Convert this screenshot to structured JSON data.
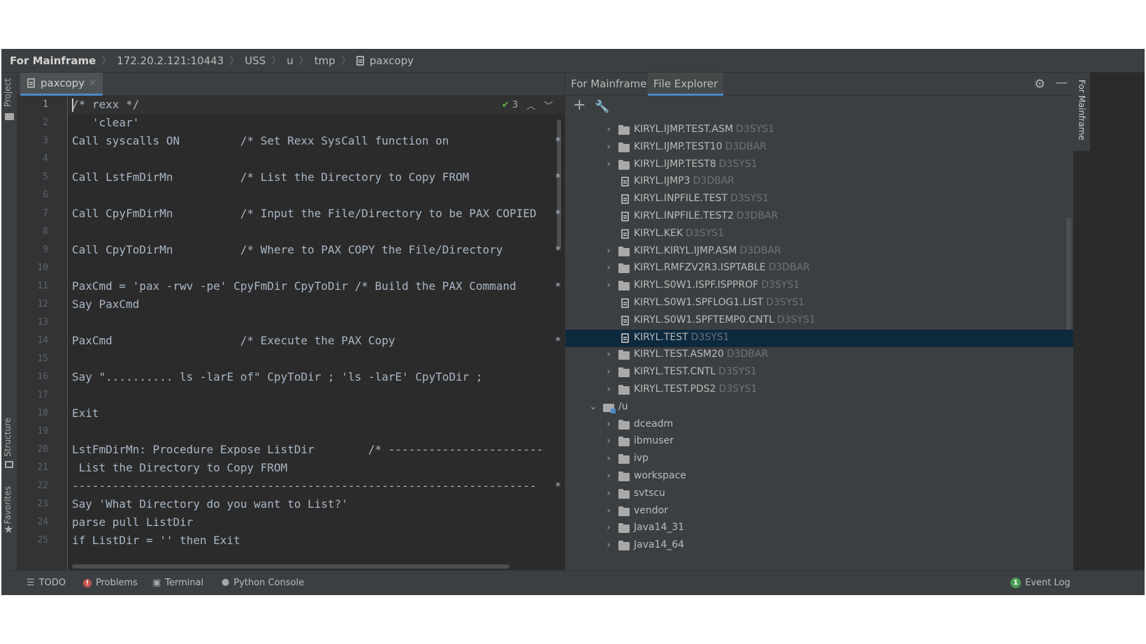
{
  "breadcrumb": {
    "items": [
      "For Mainframe",
      "172.20.2.121:10443",
      "USS",
      "u",
      "tmp"
    ],
    "file": "paxcopy"
  },
  "left_strip": {
    "project": "Project",
    "structure": "Structure",
    "favorites": "Favorites"
  },
  "editor": {
    "tab_label": "paxcopy",
    "inspection_count": "3",
    "line_numbers": [
      "1",
      "2",
      "3",
      "4",
      "5",
      "6",
      "7",
      "8",
      "9",
      "10",
      "11",
      "12",
      "13",
      "14",
      "15",
      "16",
      "17",
      "18",
      "19",
      "20",
      "21",
      "22",
      "23",
      "24",
      "25"
    ],
    "lines": [
      "/* rexx */",
      "   'clear'",
      "Call syscalls ON         /* Set Rexx SysCall function on",
      "",
      "Call LstFmDirMn          /* List the Directory to Copy FROM",
      "",
      "Call CpyFmDirMn          /* Input the File/Directory to be PAX COPIED",
      "",
      "Call CpyToDirMn          /* Where to PAX COPY the File/Directory",
      "",
      "PaxCmd = 'pax -rwv -pe' CpyFmDir CpyToDir /* Build the PAX Command",
      "Say PaxCmd",
      "",
      "PaxCmd                   /* Execute the PAX Copy",
      "",
      "Say \".......... ls -larE of\" CpyToDir ; 'ls -larE' CpyToDir ;",
      "",
      "Exit",
      "",
      "LstFmDirMn: Procedure Expose ListDir        /* -----------------------",
      " List the Directory to Copy FROM",
      "---------------------------------------------------------------------",
      "Say 'What Directory do you want to List?'",
      "parse pull ListDir",
      "if ListDir = '' then Exit"
    ],
    "star_lines": [
      3,
      5,
      7,
      9,
      11,
      14,
      22
    ]
  },
  "right_panel": {
    "tab_for_mainframe": "For Mainframe",
    "tab_file_explorer": "File Explorer",
    "tree": [
      {
        "type": "folder",
        "name": "KIRYL.IJMP.TEST.ASM",
        "owner": "D3SYS1",
        "depth": 1
      },
      {
        "type": "folder",
        "name": "KIRYL.IJMP.TEST10",
        "owner": "D3DBAR",
        "depth": 1
      },
      {
        "type": "folder",
        "name": "KIRYL.IJMP.TEST8",
        "owner": "D3SYS1",
        "depth": 1
      },
      {
        "type": "file",
        "name": "KIRYL.IJMP3",
        "owner": "D3DBAR",
        "depth": 1
      },
      {
        "type": "file",
        "name": "KIRYL.INPFILE.TEST",
        "owner": "D3SYS1",
        "depth": 1
      },
      {
        "type": "file",
        "name": "KIRYL.INPFILE.TEST2",
        "owner": "D3DBAR",
        "depth": 1
      },
      {
        "type": "file",
        "name": "KIRYL.KEK",
        "owner": "D3SYS1",
        "depth": 1
      },
      {
        "type": "folder",
        "name": "KIRYL.KIRYL.IJMP.ASM",
        "owner": "D3DBAR",
        "depth": 1
      },
      {
        "type": "folder",
        "name": "KIRYL.RMFZV2R3.ISPTABLE",
        "owner": "D3DBAR",
        "depth": 1
      },
      {
        "type": "folder",
        "name": "KIRYL.S0W1.ISPF.ISPPROF",
        "owner": "D3SYS1",
        "depth": 1
      },
      {
        "type": "file",
        "name": "KIRYL.S0W1.SPFLOG1.LIST",
        "owner": "D3SYS1",
        "depth": 1
      },
      {
        "type": "file",
        "name": "KIRYL.S0W1.SPFTEMP0.CNTL",
        "owner": "D3SYS1",
        "depth": 1
      },
      {
        "type": "file",
        "name": "KIRYL.TEST",
        "owner": "D3SYS1",
        "depth": 1,
        "selected": true
      },
      {
        "type": "folder",
        "name": "KIRYL.TEST.ASM20",
        "owner": "D3DBAR",
        "depth": 1
      },
      {
        "type": "folder",
        "name": "KIRYL.TEST.CNTL",
        "owner": "D3SYS1",
        "depth": 1
      },
      {
        "type": "folder",
        "name": "KIRYL.TEST.PDS2",
        "owner": "D3SYS1",
        "depth": 1
      },
      {
        "type": "mount",
        "name": "/u",
        "owner": "",
        "depth": 0,
        "expanded": true
      },
      {
        "type": "folder",
        "name": "dceadm",
        "owner": "",
        "depth": 1
      },
      {
        "type": "folder",
        "name": "ibmuser",
        "owner": "",
        "depth": 1
      },
      {
        "type": "folder",
        "name": "ivp",
        "owner": "",
        "depth": 1
      },
      {
        "type": "folder",
        "name": "workspace",
        "owner": "",
        "depth": 1
      },
      {
        "type": "folder",
        "name": "svtscu",
        "owner": "",
        "depth": 1
      },
      {
        "type": "folder",
        "name": "vendor",
        "owner": "",
        "depth": 1
      },
      {
        "type": "folder",
        "name": "Java14_31",
        "owner": "",
        "depth": 1
      },
      {
        "type": "folder",
        "name": "Java14_64",
        "owner": "",
        "depth": 1
      }
    ]
  },
  "right_strip": {
    "label": "For Mainframe"
  },
  "status_bar": {
    "todo": "TODO",
    "problems": "Problems",
    "terminal": "Terminal",
    "python_console": "Python Console",
    "event_log_count": "1",
    "event_log": "Event Log"
  }
}
